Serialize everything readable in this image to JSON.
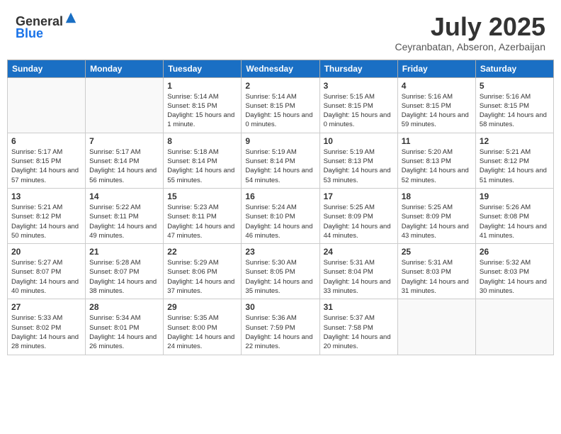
{
  "header": {
    "logo_general": "General",
    "logo_blue": "Blue",
    "title": "July 2025",
    "location": "Ceyranbatan, Abseron, Azerbaijan"
  },
  "days_of_week": [
    "Sunday",
    "Monday",
    "Tuesday",
    "Wednesday",
    "Thursday",
    "Friday",
    "Saturday"
  ],
  "weeks": [
    [
      {
        "day": "",
        "sunrise": "",
        "sunset": "",
        "daylight": ""
      },
      {
        "day": "",
        "sunrise": "",
        "sunset": "",
        "daylight": ""
      },
      {
        "day": "1",
        "sunrise": "Sunrise: 5:14 AM",
        "sunset": "Sunset: 8:15 PM",
        "daylight": "Daylight: 15 hours and 1 minute."
      },
      {
        "day": "2",
        "sunrise": "Sunrise: 5:14 AM",
        "sunset": "Sunset: 8:15 PM",
        "daylight": "Daylight: 15 hours and 0 minutes."
      },
      {
        "day": "3",
        "sunrise": "Sunrise: 5:15 AM",
        "sunset": "Sunset: 8:15 PM",
        "daylight": "Daylight: 15 hours and 0 minutes."
      },
      {
        "day": "4",
        "sunrise": "Sunrise: 5:16 AM",
        "sunset": "Sunset: 8:15 PM",
        "daylight": "Daylight: 14 hours and 59 minutes."
      },
      {
        "day": "5",
        "sunrise": "Sunrise: 5:16 AM",
        "sunset": "Sunset: 8:15 PM",
        "daylight": "Daylight: 14 hours and 58 minutes."
      }
    ],
    [
      {
        "day": "6",
        "sunrise": "Sunrise: 5:17 AM",
        "sunset": "Sunset: 8:15 PM",
        "daylight": "Daylight: 14 hours and 57 minutes."
      },
      {
        "day": "7",
        "sunrise": "Sunrise: 5:17 AM",
        "sunset": "Sunset: 8:14 PM",
        "daylight": "Daylight: 14 hours and 56 minutes."
      },
      {
        "day": "8",
        "sunrise": "Sunrise: 5:18 AM",
        "sunset": "Sunset: 8:14 PM",
        "daylight": "Daylight: 14 hours and 55 minutes."
      },
      {
        "day": "9",
        "sunrise": "Sunrise: 5:19 AM",
        "sunset": "Sunset: 8:14 PM",
        "daylight": "Daylight: 14 hours and 54 minutes."
      },
      {
        "day": "10",
        "sunrise": "Sunrise: 5:19 AM",
        "sunset": "Sunset: 8:13 PM",
        "daylight": "Daylight: 14 hours and 53 minutes."
      },
      {
        "day": "11",
        "sunrise": "Sunrise: 5:20 AM",
        "sunset": "Sunset: 8:13 PM",
        "daylight": "Daylight: 14 hours and 52 minutes."
      },
      {
        "day": "12",
        "sunrise": "Sunrise: 5:21 AM",
        "sunset": "Sunset: 8:12 PM",
        "daylight": "Daylight: 14 hours and 51 minutes."
      }
    ],
    [
      {
        "day": "13",
        "sunrise": "Sunrise: 5:21 AM",
        "sunset": "Sunset: 8:12 PM",
        "daylight": "Daylight: 14 hours and 50 minutes."
      },
      {
        "day": "14",
        "sunrise": "Sunrise: 5:22 AM",
        "sunset": "Sunset: 8:11 PM",
        "daylight": "Daylight: 14 hours and 49 minutes."
      },
      {
        "day": "15",
        "sunrise": "Sunrise: 5:23 AM",
        "sunset": "Sunset: 8:11 PM",
        "daylight": "Daylight: 14 hours and 47 minutes."
      },
      {
        "day": "16",
        "sunrise": "Sunrise: 5:24 AM",
        "sunset": "Sunset: 8:10 PM",
        "daylight": "Daylight: 14 hours and 46 minutes."
      },
      {
        "day": "17",
        "sunrise": "Sunrise: 5:25 AM",
        "sunset": "Sunset: 8:09 PM",
        "daylight": "Daylight: 14 hours and 44 minutes."
      },
      {
        "day": "18",
        "sunrise": "Sunrise: 5:25 AM",
        "sunset": "Sunset: 8:09 PM",
        "daylight": "Daylight: 14 hours and 43 minutes."
      },
      {
        "day": "19",
        "sunrise": "Sunrise: 5:26 AM",
        "sunset": "Sunset: 8:08 PM",
        "daylight": "Daylight: 14 hours and 41 minutes."
      }
    ],
    [
      {
        "day": "20",
        "sunrise": "Sunrise: 5:27 AM",
        "sunset": "Sunset: 8:07 PM",
        "daylight": "Daylight: 14 hours and 40 minutes."
      },
      {
        "day": "21",
        "sunrise": "Sunrise: 5:28 AM",
        "sunset": "Sunset: 8:07 PM",
        "daylight": "Daylight: 14 hours and 38 minutes."
      },
      {
        "day": "22",
        "sunrise": "Sunrise: 5:29 AM",
        "sunset": "Sunset: 8:06 PM",
        "daylight": "Daylight: 14 hours and 37 minutes."
      },
      {
        "day": "23",
        "sunrise": "Sunrise: 5:30 AM",
        "sunset": "Sunset: 8:05 PM",
        "daylight": "Daylight: 14 hours and 35 minutes."
      },
      {
        "day": "24",
        "sunrise": "Sunrise: 5:31 AM",
        "sunset": "Sunset: 8:04 PM",
        "daylight": "Daylight: 14 hours and 33 minutes."
      },
      {
        "day": "25",
        "sunrise": "Sunrise: 5:31 AM",
        "sunset": "Sunset: 8:03 PM",
        "daylight": "Daylight: 14 hours and 31 minutes."
      },
      {
        "day": "26",
        "sunrise": "Sunrise: 5:32 AM",
        "sunset": "Sunset: 8:03 PM",
        "daylight": "Daylight: 14 hours and 30 minutes."
      }
    ],
    [
      {
        "day": "27",
        "sunrise": "Sunrise: 5:33 AM",
        "sunset": "Sunset: 8:02 PM",
        "daylight": "Daylight: 14 hours and 28 minutes."
      },
      {
        "day": "28",
        "sunrise": "Sunrise: 5:34 AM",
        "sunset": "Sunset: 8:01 PM",
        "daylight": "Daylight: 14 hours and 26 minutes."
      },
      {
        "day": "29",
        "sunrise": "Sunrise: 5:35 AM",
        "sunset": "Sunset: 8:00 PM",
        "daylight": "Daylight: 14 hours and 24 minutes."
      },
      {
        "day": "30",
        "sunrise": "Sunrise: 5:36 AM",
        "sunset": "Sunset: 7:59 PM",
        "daylight": "Daylight: 14 hours and 22 minutes."
      },
      {
        "day": "31",
        "sunrise": "Sunrise: 5:37 AM",
        "sunset": "Sunset: 7:58 PM",
        "daylight": "Daylight: 14 hours and 20 minutes."
      },
      {
        "day": "",
        "sunrise": "",
        "sunset": "",
        "daylight": ""
      },
      {
        "day": "",
        "sunrise": "",
        "sunset": "",
        "daylight": ""
      }
    ]
  ]
}
